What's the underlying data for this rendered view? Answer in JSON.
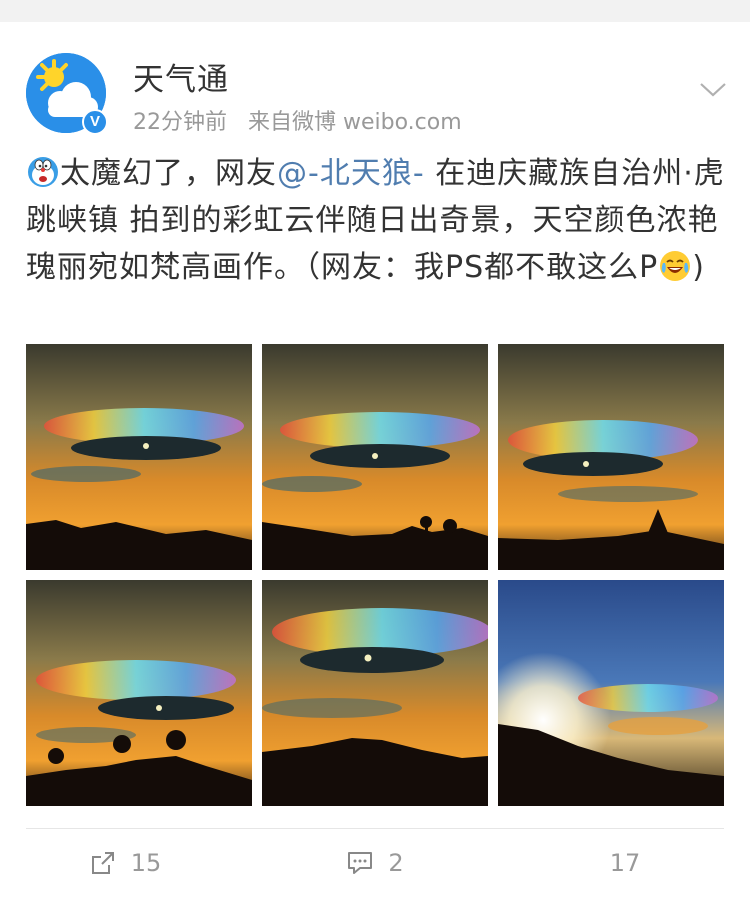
{
  "post": {
    "username": "天气通",
    "verified_badge": "V",
    "time": "22分钟前",
    "source": "来自微博 weibo.com",
    "text_before": "太魔幻了，网友",
    "mention": "@-北天狼-",
    "text_after": " 在迪庆藏族自治州·虎跳峡镇 拍到的彩虹云伴随日出奇景，天空颜色浓艳瑰丽宛如梵高画作。（网友：我PS都不敢这么P",
    "text_end": ")"
  },
  "images": [
    {
      "name": "photo-1",
      "style": "sunset-rainbow-cloud"
    },
    {
      "name": "photo-2",
      "style": "sunset-rainbow-cloud"
    },
    {
      "name": "photo-3",
      "style": "sunset-rainbow-cloud"
    },
    {
      "name": "photo-4",
      "style": "sunset-rainbow-cloud"
    },
    {
      "name": "photo-5",
      "style": "sunset-rainbow-cloud"
    },
    {
      "name": "photo-6",
      "style": "blue-sky-rainbow-cloud"
    }
  ],
  "actions": {
    "repost_count": "15",
    "comment_count": "2",
    "like_count": "17"
  },
  "icons": {
    "avatar": "sun-cloud-icon",
    "menu": "chevron-down-icon",
    "repost": "repost-icon",
    "comment": "comment-icon",
    "like": "like-icon"
  },
  "colors": {
    "accent": "#2a8fe8",
    "mention": "#507daf",
    "text": "#333333",
    "meta": "#999999"
  }
}
